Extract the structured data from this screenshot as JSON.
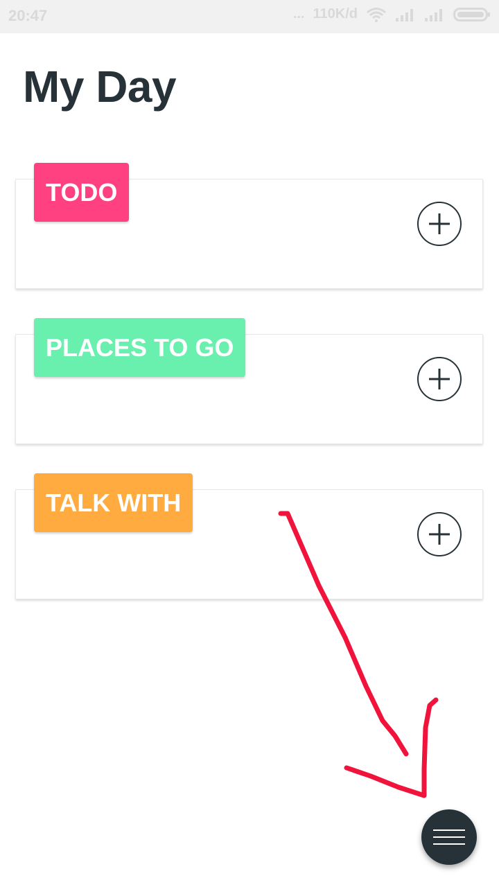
{
  "status_bar": {
    "time": "20:47",
    "dots": "...",
    "net_speed": "110K/d",
    "icons": [
      "wifi-icon",
      "signal-icon",
      "signal-icon",
      "battery-icon"
    ]
  },
  "page": {
    "title": "My Day"
  },
  "cards": [
    {
      "label": "TODO",
      "color": "#ff4081",
      "add_icon": "plus-circle-icon"
    },
    {
      "label": "PLACES TO GO",
      "color": "#69f0ae",
      "add_icon": "plus-circle-icon"
    },
    {
      "label": "TALK WITH",
      "color": "#ffab40",
      "add_icon": "plus-circle-icon"
    }
  ],
  "fab": {
    "icon": "menu-icon",
    "color": "#263238"
  },
  "annotation": {
    "color": "#f0143c"
  }
}
